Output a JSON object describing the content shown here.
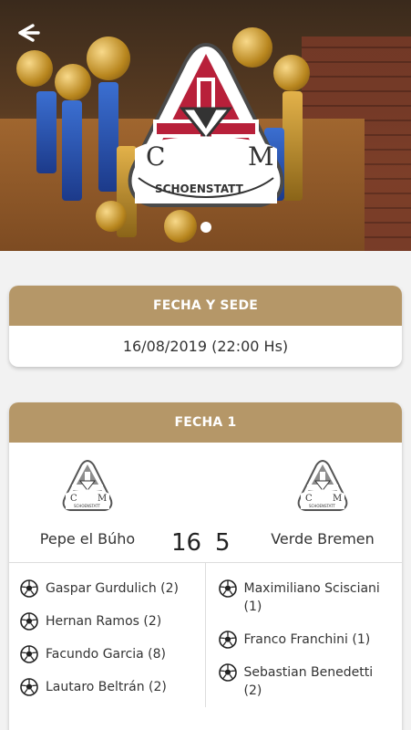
{
  "header": {
    "back_icon": "arrow-left-icon"
  },
  "hero": {
    "logo_letters_left": "C",
    "logo_letters_right": "M",
    "logo_text": "SCHOENSTATT",
    "carousel_active": 1,
    "carousel_total": 1
  },
  "info_card": {
    "title": "FECHA Y SEDE",
    "datetime": "16/08/2019 (22:00 Hs)"
  },
  "match_card": {
    "title": "FECHA 1",
    "home_team": "Pepe el Búho",
    "away_team": "Verde Bremen",
    "home_score": "16",
    "away_score": "5",
    "home_scorers": [
      "Gaspar Gurdulich (2)",
      "Hernan Ramos (2)",
      "Facundo Garcia (8)",
      "Lautaro Beltrán (2)"
    ],
    "away_scorers": [
      "Maximiliano Scisciani (1)",
      "Franco Franchini (1)",
      "Sebastian Benedetti (2)"
    ]
  },
  "colors": {
    "accent": "#b59768",
    "logo_red": "#b8203a"
  }
}
